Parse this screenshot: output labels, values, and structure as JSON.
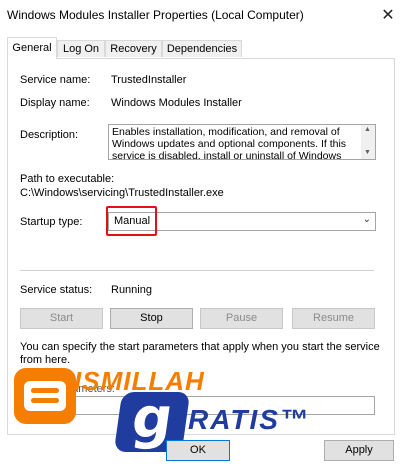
{
  "window": {
    "title": "Windows Modules Installer Properties (Local Computer)",
    "close_glyph": "✕"
  },
  "tabs": [
    {
      "label": "General",
      "active": true
    },
    {
      "label": "Log On",
      "active": false
    },
    {
      "label": "Recovery",
      "active": false
    },
    {
      "label": "Dependencies",
      "active": false
    }
  ],
  "general": {
    "service_name_label": "Service name:",
    "service_name": "TrustedInstaller",
    "display_name_label": "Display name:",
    "display_name": "Windows Modules Installer",
    "description_label": "Description:",
    "description": "Enables installation, modification, and removal of Windows updates and optional components. If this service is disabled, install or uninstall of Windows",
    "path_label": "Path to executable:",
    "path": "C:\\Windows\\servicing\\TrustedInstaller.exe",
    "startup_type_label": "Startup type:",
    "startup_type": "Manual",
    "status_label": "Service status:",
    "status": "Running",
    "buttons": {
      "start": "Start",
      "stop": "Stop",
      "pause": "Pause",
      "resume": "Resume"
    },
    "info_text_line1": "You can specify the start parameters that apply when you start the service",
    "info_text_line2": "from here.",
    "start_params_label": "Start parameters:"
  },
  "footer": {
    "ok": "OK",
    "apply": "Apply"
  },
  "watermark": {
    "line1": "ISMILLAH",
    "line2": "RATIS™",
    "b_letter": "B",
    "g_letter": "g"
  },
  "colors": {
    "highlight": "#e3101c",
    "blogger_orange": "#f57d00",
    "watermark_blue": "#1f3c9e"
  }
}
